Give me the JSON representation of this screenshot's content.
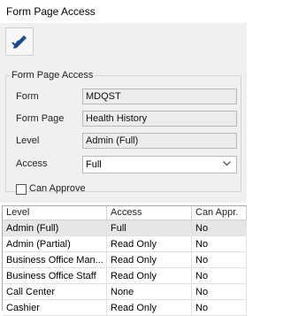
{
  "window": {
    "title": "Form Page Access"
  },
  "toolbar": {
    "edit_icon": "pencil-check-icon"
  },
  "form": {
    "group_title": "Form Page Access",
    "fields": {
      "form_label": "Form",
      "form_value": "MDQST",
      "page_label": "Form Page",
      "page_value": "Health History",
      "level_label": "Level",
      "level_value": "Admin (Full)",
      "access_label": "Access",
      "access_value": "Full"
    },
    "can_approve_label": "Can Approve",
    "can_approve_checked": false
  },
  "grid": {
    "columns": [
      "Level",
      "Access",
      "Can Appr."
    ],
    "rows": [
      {
        "level": "Admin (Full)",
        "access": "Full",
        "can_approve": "No",
        "selected": true
      },
      {
        "level": "Admin (Partial)",
        "access": "Read Only",
        "can_approve": "No",
        "selected": false
      },
      {
        "level": "Business Office Man...",
        "access": "Read Only",
        "can_approve": "No",
        "selected": false
      },
      {
        "level": "Business Office Staff",
        "access": "Read Only",
        "can_approve": "No",
        "selected": false
      },
      {
        "level": "Call Center",
        "access": "None",
        "can_approve": "No",
        "selected": false
      },
      {
        "level": "Cashier",
        "access": "Read Only",
        "can_approve": "No",
        "selected": false
      }
    ]
  },
  "colors": {
    "panel": "#f0f0f0",
    "selected_row": "#e6e6e6",
    "icon_blue": "#1a4a8a"
  }
}
